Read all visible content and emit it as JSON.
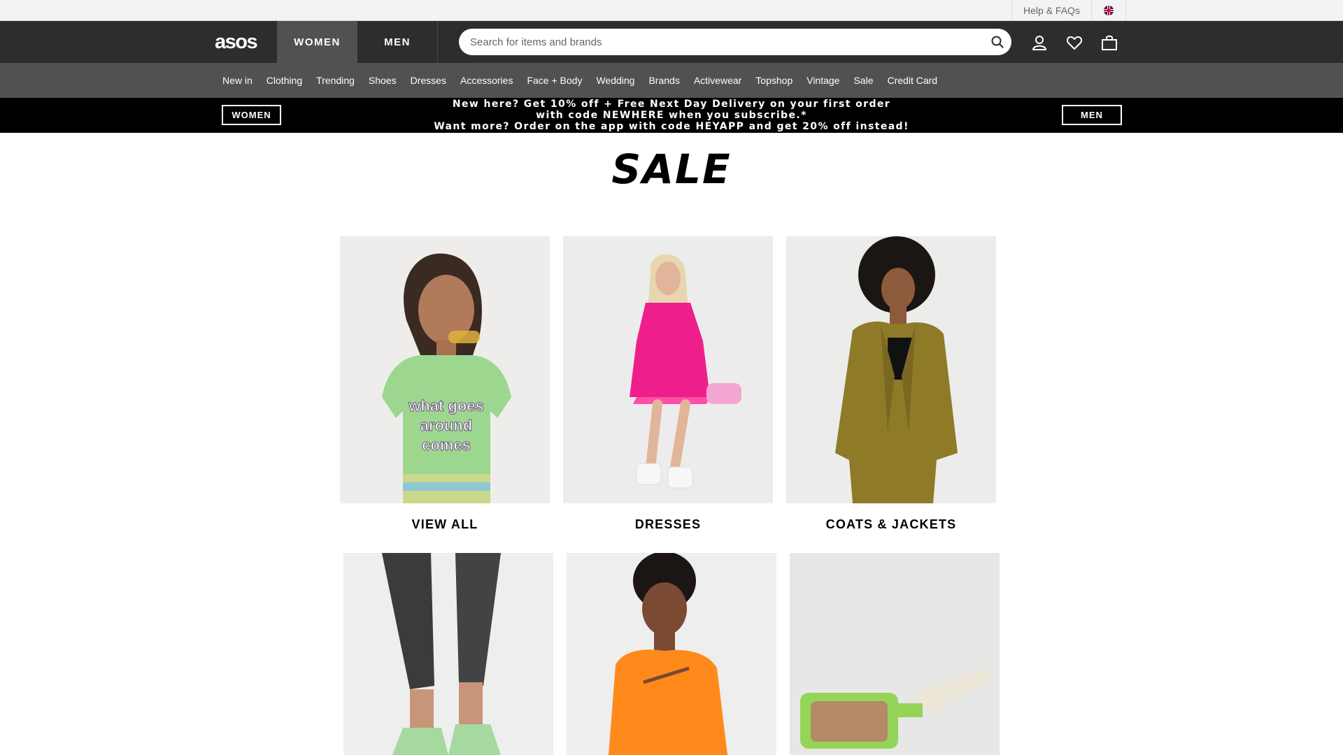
{
  "topbar": {
    "help_label": "Help & FAQs",
    "flag_icon": "uk-flag-icon"
  },
  "header": {
    "logo": "asos",
    "tabs": [
      {
        "label": "WOMEN"
      },
      {
        "label": "MEN"
      }
    ],
    "search": {
      "placeholder": "Search for items and brands",
      "value": ""
    },
    "icons": [
      "search-icon",
      "account-icon",
      "heart-icon",
      "bag-icon"
    ]
  },
  "categories": [
    {
      "label": "New in"
    },
    {
      "label": "Clothing"
    },
    {
      "label": "Trending"
    },
    {
      "label": "Shoes"
    },
    {
      "label": "Dresses"
    },
    {
      "label": "Accessories"
    },
    {
      "label": "Face + Body"
    },
    {
      "label": "Wedding"
    },
    {
      "label": "Brands"
    },
    {
      "label": "Activewear"
    },
    {
      "label": "Topshop"
    },
    {
      "label": "Vintage"
    },
    {
      "label": "Sale"
    },
    {
      "label": "Credit Card"
    }
  ],
  "promo": {
    "women_label": "WOMEN",
    "men_label": "MEN",
    "lines": [
      "New here? Get 10% off + Free Next Day Delivery on your first order",
      "with code NEWHERE when you subscribe.*",
      "Want more? Order on the app with code HEYAPP and get 20% off instead!"
    ]
  },
  "page_title": "SALE",
  "products": [
    {
      "label": "VIEW ALL"
    },
    {
      "label": "DRESSES"
    },
    {
      "label": "COATS & JACKETS"
    },
    {
      "label": ""
    },
    {
      "label": ""
    },
    {
      "label": ""
    }
  ],
  "colors": {
    "header_bg": "#2d2d2d",
    "nav_bg": "#525050",
    "promo_bg": "#000000"
  }
}
